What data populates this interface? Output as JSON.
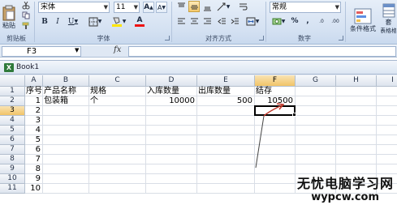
{
  "ribbon": {
    "clipboard": {
      "paste_label": "粘贴",
      "group_label": "剪贴板"
    },
    "font": {
      "font_name": "宋体",
      "font_size": "11",
      "group_label": "字体",
      "bold": "B",
      "italic": "I",
      "underline": "U",
      "grow": "A",
      "shrink": "A",
      "color_a": "A"
    },
    "alignment": {
      "group_label": "对齐方式"
    },
    "number": {
      "format": "常规",
      "group_label": "数字",
      "percent": "%",
      "comma": ",",
      "inc": ".0",
      "dec": ".00"
    },
    "styles": {
      "cond_format": "条件格式",
      "table_format_short": "套",
      "table_format_line2": "表格格"
    }
  },
  "formula_bar": {
    "name_box": "F3",
    "fx": "fx",
    "formula": ""
  },
  "workbook": {
    "title": "Book1",
    "icon_letter": "X"
  },
  "sheet": {
    "columns": [
      "A",
      "B",
      "C",
      "D",
      "E",
      "F",
      "G",
      "H",
      "I"
    ],
    "rows": [
      "1",
      "2",
      "3",
      "4",
      "5",
      "6",
      "7",
      "8",
      "9",
      "10",
      "11"
    ],
    "cells": {
      "A1": "序号",
      "B1": "产品名称",
      "C1": "规格",
      "D1": "入库数量",
      "E1": "出库数量",
      "F1": "结存",
      "A2": "1",
      "B2": "包装箱",
      "C2": "个",
      "D2": "10000",
      "E2": "500",
      "F2": "10500",
      "A3": "2",
      "A4": "3",
      "A5": "4",
      "A6": "5",
      "A7": "6",
      "A8": "7",
      "A9": "8",
      "A10": "9",
      "A11": "10"
    },
    "active_cell": "F3"
  },
  "watermark": {
    "line1": "无忧电脑学习网",
    "line2": "wypcw.com"
  },
  "colors": {
    "ribbon_bg": "#d4e1f2",
    "annotation": "#c0392b",
    "selected_header": "#f1c467"
  }
}
